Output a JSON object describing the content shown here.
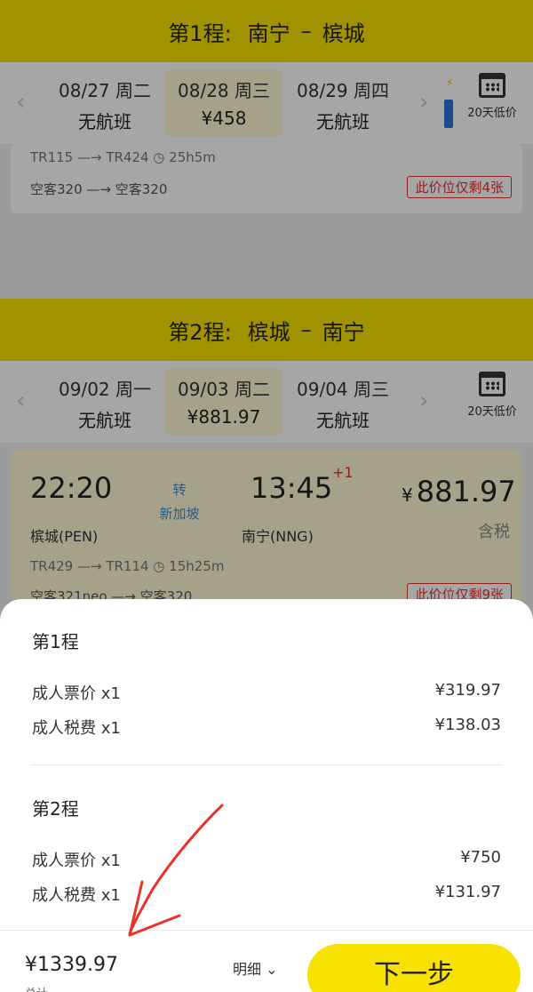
{
  "leg1": {
    "label": "第1程:",
    "from": "南宁",
    "to": "槟城",
    "dash": "–",
    "dates": [
      {
        "date": "08/27 周二",
        "price": "无航班",
        "selected": false
      },
      {
        "date": "08/28 周三",
        "price": "¥458",
        "selected": true
      },
      {
        "date": "08/29 周四",
        "price": "无航班",
        "selected": false
      }
    ],
    "calendar_label": "20天低价",
    "flight_line": "TR115 —→ TR424 ◷ 25h5m",
    "aircraft_line": "空客320 —→ 空客320",
    "seats": "此价位仅剩4张"
  },
  "leg2": {
    "label": "第2程:",
    "from": "槟城",
    "to": "南宁",
    "dash": "–",
    "dates": [
      {
        "date": "09/02 周一",
        "price": "无航班",
        "selected": false
      },
      {
        "date": "09/03 周二",
        "price": "¥881.97",
        "selected": true
      },
      {
        "date": "09/04 周三",
        "price": "无航班",
        "selected": false
      }
    ],
    "calendar_label": "20天低价",
    "depart_time": "22:20",
    "arrive_time": "13:45",
    "plus_day": "+1",
    "transfer_label": "转",
    "transfer_city": "新加坡",
    "depart_city": "槟城(PEN)",
    "arrive_city": "南宁(NNG)",
    "price_symbol": "¥",
    "price": "881.97",
    "tax_label": "含税",
    "flight_line": "TR429 —→ TR114 ◷ 15h25m",
    "aircraft_line": "空客321neo —→ 空客320",
    "seats": "此价位仅剩9张"
  },
  "sheet": {
    "leg1_title": "第1程",
    "leg1_rows": [
      {
        "label": "成人票价 x1",
        "value": "¥319.97"
      },
      {
        "label": "成人税费 x1",
        "value": "¥138.03"
      }
    ],
    "leg2_title": "第2程",
    "leg2_rows": [
      {
        "label": "成人票价 x1",
        "value": "¥750"
      },
      {
        "label": "成人税费 x1",
        "value": "¥131.97"
      }
    ]
  },
  "footer": {
    "total": "¥1339.97",
    "total_label": "总计",
    "detail_label": "明细 ⌄",
    "next_label": "下一步"
  },
  "colors": {
    "brand_yellow": "#f7e100",
    "alert_red": "#e0342c",
    "transfer_blue": "#3d8fd1",
    "annotation_red": "#e8322a"
  },
  "icons": {
    "prev": "chevron-left-icon",
    "next": "chevron-right-icon",
    "calendar": "calendar-icon",
    "clock": "clock-icon"
  }
}
